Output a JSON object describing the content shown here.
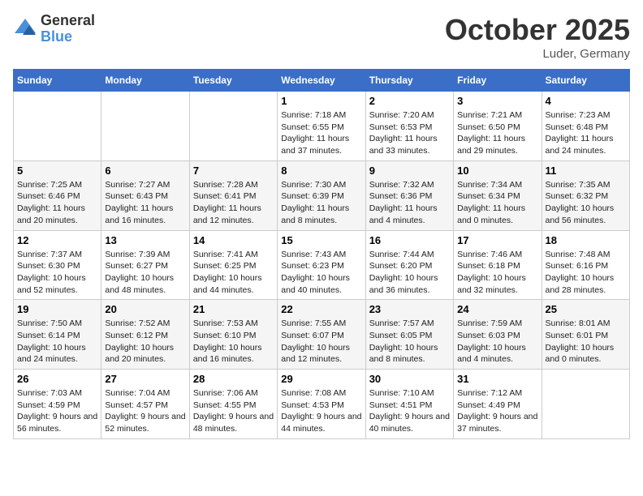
{
  "header": {
    "logo_general": "General",
    "logo_blue": "Blue",
    "month": "October 2025",
    "location": "Luder, Germany"
  },
  "weekdays": [
    "Sunday",
    "Monday",
    "Tuesday",
    "Wednesday",
    "Thursday",
    "Friday",
    "Saturday"
  ],
  "weeks": [
    [
      {
        "day": "",
        "info": ""
      },
      {
        "day": "",
        "info": ""
      },
      {
        "day": "",
        "info": ""
      },
      {
        "day": "1",
        "info": "Sunrise: 7:18 AM\nSunset: 6:55 PM\nDaylight: 11 hours and 37 minutes."
      },
      {
        "day": "2",
        "info": "Sunrise: 7:20 AM\nSunset: 6:53 PM\nDaylight: 11 hours and 33 minutes."
      },
      {
        "day": "3",
        "info": "Sunrise: 7:21 AM\nSunset: 6:50 PM\nDaylight: 11 hours and 29 minutes."
      },
      {
        "day": "4",
        "info": "Sunrise: 7:23 AM\nSunset: 6:48 PM\nDaylight: 11 hours and 24 minutes."
      }
    ],
    [
      {
        "day": "5",
        "info": "Sunrise: 7:25 AM\nSunset: 6:46 PM\nDaylight: 11 hours and 20 minutes."
      },
      {
        "day": "6",
        "info": "Sunrise: 7:27 AM\nSunset: 6:43 PM\nDaylight: 11 hours and 16 minutes."
      },
      {
        "day": "7",
        "info": "Sunrise: 7:28 AM\nSunset: 6:41 PM\nDaylight: 11 hours and 12 minutes."
      },
      {
        "day": "8",
        "info": "Sunrise: 7:30 AM\nSunset: 6:39 PM\nDaylight: 11 hours and 8 minutes."
      },
      {
        "day": "9",
        "info": "Sunrise: 7:32 AM\nSunset: 6:36 PM\nDaylight: 11 hours and 4 minutes."
      },
      {
        "day": "10",
        "info": "Sunrise: 7:34 AM\nSunset: 6:34 PM\nDaylight: 11 hours and 0 minutes."
      },
      {
        "day": "11",
        "info": "Sunrise: 7:35 AM\nSunset: 6:32 PM\nDaylight: 10 hours and 56 minutes."
      }
    ],
    [
      {
        "day": "12",
        "info": "Sunrise: 7:37 AM\nSunset: 6:30 PM\nDaylight: 10 hours and 52 minutes."
      },
      {
        "day": "13",
        "info": "Sunrise: 7:39 AM\nSunset: 6:27 PM\nDaylight: 10 hours and 48 minutes."
      },
      {
        "day": "14",
        "info": "Sunrise: 7:41 AM\nSunset: 6:25 PM\nDaylight: 10 hours and 44 minutes."
      },
      {
        "day": "15",
        "info": "Sunrise: 7:43 AM\nSunset: 6:23 PM\nDaylight: 10 hours and 40 minutes."
      },
      {
        "day": "16",
        "info": "Sunrise: 7:44 AM\nSunset: 6:20 PM\nDaylight: 10 hours and 36 minutes."
      },
      {
        "day": "17",
        "info": "Sunrise: 7:46 AM\nSunset: 6:18 PM\nDaylight: 10 hours and 32 minutes."
      },
      {
        "day": "18",
        "info": "Sunrise: 7:48 AM\nSunset: 6:16 PM\nDaylight: 10 hours and 28 minutes."
      }
    ],
    [
      {
        "day": "19",
        "info": "Sunrise: 7:50 AM\nSunset: 6:14 PM\nDaylight: 10 hours and 24 minutes."
      },
      {
        "day": "20",
        "info": "Sunrise: 7:52 AM\nSunset: 6:12 PM\nDaylight: 10 hours and 20 minutes."
      },
      {
        "day": "21",
        "info": "Sunrise: 7:53 AM\nSunset: 6:10 PM\nDaylight: 10 hours and 16 minutes."
      },
      {
        "day": "22",
        "info": "Sunrise: 7:55 AM\nSunset: 6:07 PM\nDaylight: 10 hours and 12 minutes."
      },
      {
        "day": "23",
        "info": "Sunrise: 7:57 AM\nSunset: 6:05 PM\nDaylight: 10 hours and 8 minutes."
      },
      {
        "day": "24",
        "info": "Sunrise: 7:59 AM\nSunset: 6:03 PM\nDaylight: 10 hours and 4 minutes."
      },
      {
        "day": "25",
        "info": "Sunrise: 8:01 AM\nSunset: 6:01 PM\nDaylight: 10 hours and 0 minutes."
      }
    ],
    [
      {
        "day": "26",
        "info": "Sunrise: 7:03 AM\nSunset: 4:59 PM\nDaylight: 9 hours and 56 minutes."
      },
      {
        "day": "27",
        "info": "Sunrise: 7:04 AM\nSunset: 4:57 PM\nDaylight: 9 hours and 52 minutes."
      },
      {
        "day": "28",
        "info": "Sunrise: 7:06 AM\nSunset: 4:55 PM\nDaylight: 9 hours and 48 minutes."
      },
      {
        "day": "29",
        "info": "Sunrise: 7:08 AM\nSunset: 4:53 PM\nDaylight: 9 hours and 44 minutes."
      },
      {
        "day": "30",
        "info": "Sunrise: 7:10 AM\nSunset: 4:51 PM\nDaylight: 9 hours and 40 minutes."
      },
      {
        "day": "31",
        "info": "Sunrise: 7:12 AM\nSunset: 4:49 PM\nDaylight: 9 hours and 37 minutes."
      },
      {
        "day": "",
        "info": ""
      }
    ]
  ]
}
